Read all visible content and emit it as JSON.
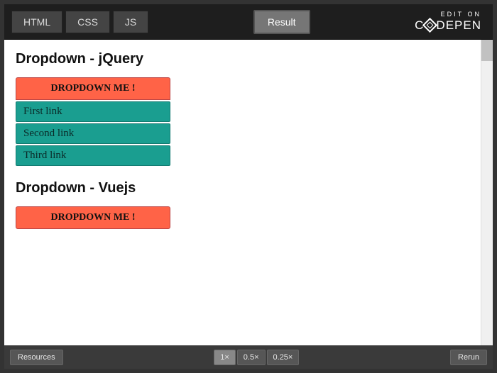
{
  "header": {
    "tabs": [
      "HTML",
      "CSS",
      "JS"
    ],
    "result_label": "Result",
    "edit_on": "EDIT ON",
    "brand": "CODEPEN"
  },
  "page": {
    "section1": {
      "title": "Dropdown - jQuery",
      "trigger": "DROPDOWN ME !",
      "items": [
        "First link",
        "Second link",
        "Third link"
      ]
    },
    "section2": {
      "title": "Dropdown - Vuejs",
      "trigger": "DROPDOWN ME !"
    }
  },
  "footer": {
    "resources": "Resources",
    "zoom": [
      "1×",
      "0.5×",
      "0.25×"
    ],
    "rerun": "Rerun"
  }
}
